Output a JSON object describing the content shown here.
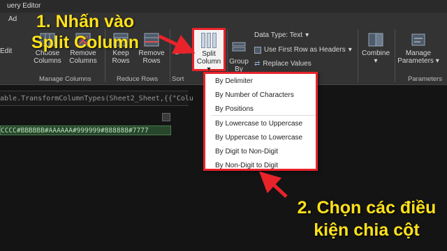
{
  "window": {
    "title": "uery Editor"
  },
  "ribbon": {
    "tab_hint": "Ad",
    "edit_hint": "Edit",
    "buttons": {
      "choose_columns": "Choose Columns",
      "remove_columns": "Remove Columns",
      "keep_rows": "Keep Rows",
      "remove_rows": "Remove Rows",
      "split_column_line1": "Split",
      "split_column_line2": "Column",
      "group_by_line1": "Group",
      "group_by_line2": "By",
      "combine": "Combine",
      "manage_parameters": "Manage Parameters"
    },
    "small_cmds": {
      "data_type": "Data Type: Text",
      "use_first_row": "Use First Row as Headers",
      "replace_values": "Replace Values"
    },
    "groups": {
      "manage_columns": "Manage Columns",
      "reduce_rows": "Reduce Rows",
      "sort": "Sort",
      "parameters": "Parameters"
    }
  },
  "formula": {
    "text": "able.TransformColumnTypes(Sheet2_Sheet,{{\"Colu"
  },
  "cell": {
    "text": "CCCC#BBBBBB#AAAAAA#999999#888888#7777"
  },
  "split_menu": {
    "items": [
      "By Delimiter",
      "By Number of Characters",
      "By Positions",
      "By Lowercase to Uppercase",
      "By Uppercase to Lowercase",
      "By Digit to Non-Digit",
      "By Non-Digit to Digit"
    ]
  },
  "annotations": {
    "step1_line1": "1. Nhấn vào",
    "step1_line2": "Split Column",
    "step2_line1": "2. Chọn các điều",
    "step2_line2": "kiện chia cột",
    "color": "#ffe11a",
    "arrow_color": "#e8232a"
  }
}
